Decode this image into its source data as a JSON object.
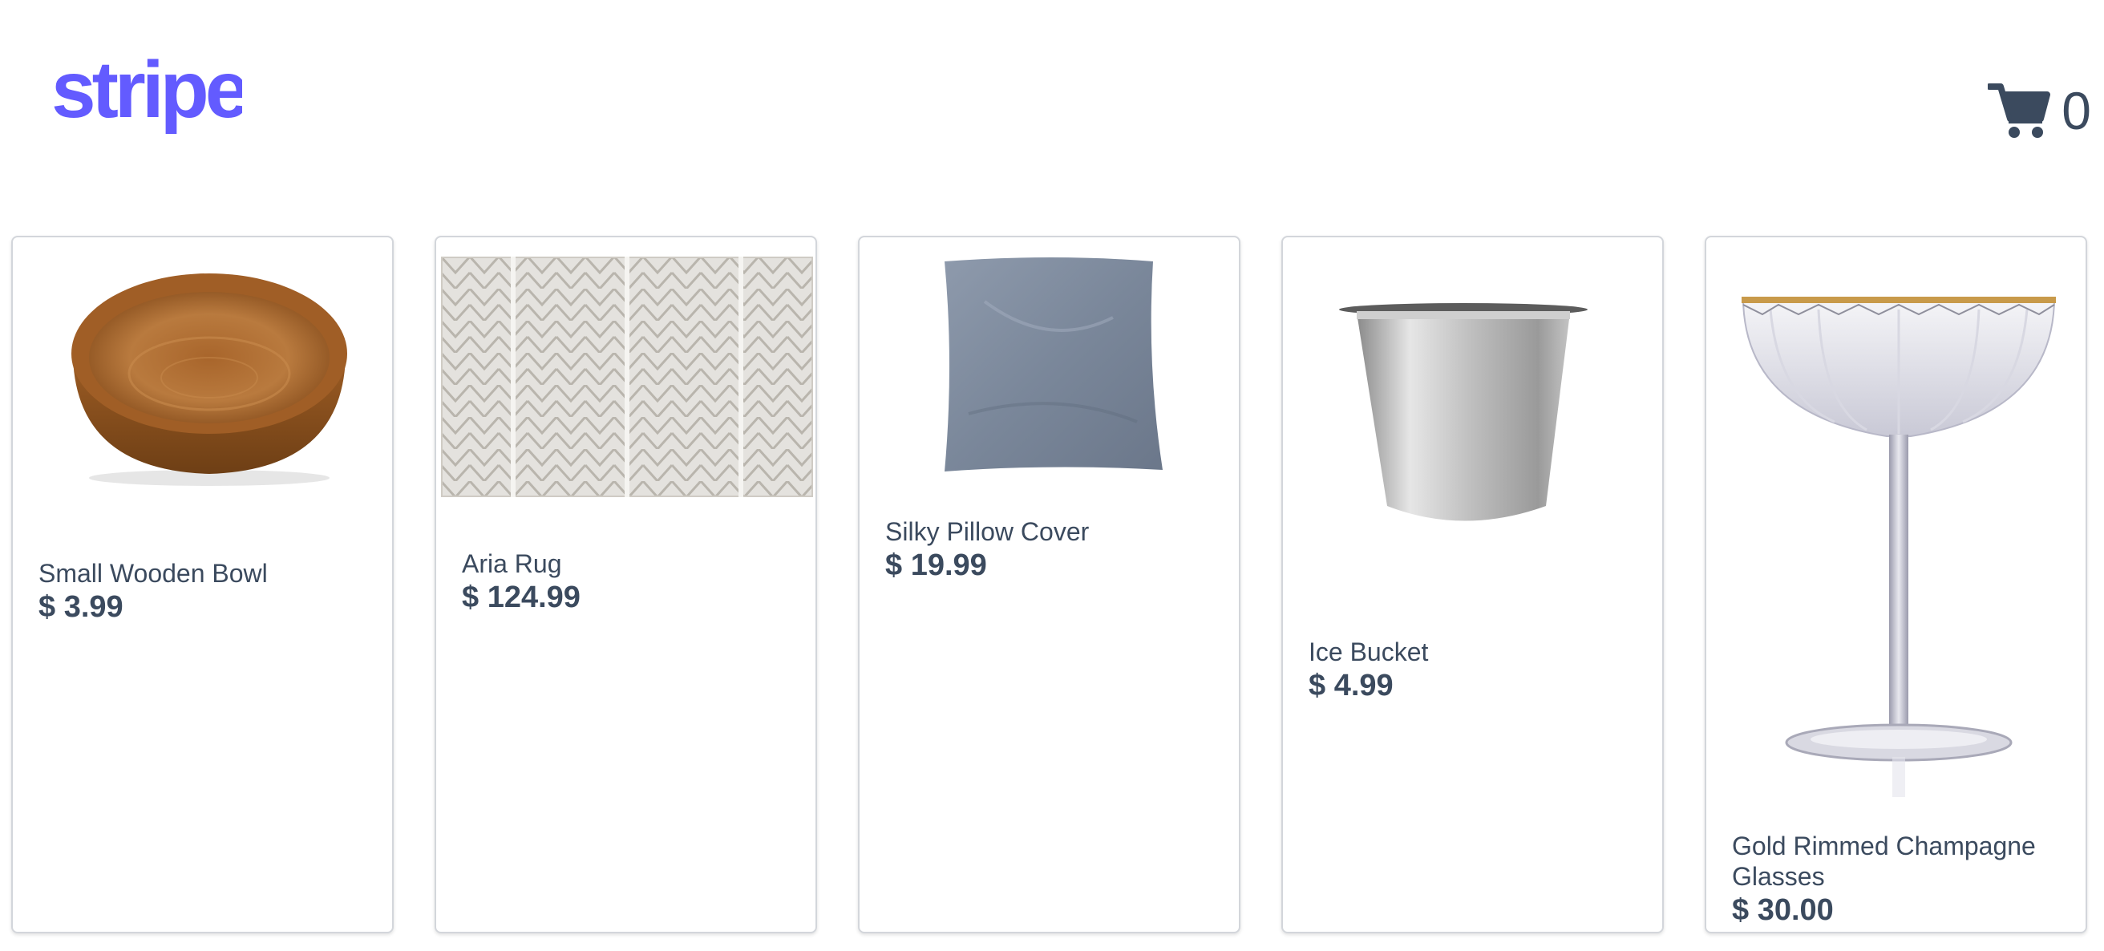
{
  "header": {
    "logo_text": "stripe",
    "logo_color": "#635bff",
    "cart_icon": "shopping-cart-icon",
    "cart_count": "0"
  },
  "products": [
    {
      "name": "Small Wooden Bowl",
      "price": "$ 3.99",
      "image": "wooden-bowl-image"
    },
    {
      "name": "Aria Rug",
      "price": "$ 124.99",
      "image": "rug-image"
    },
    {
      "name": "Silky Pillow Cover",
      "price": "$ 19.99",
      "image": "pillow-image"
    },
    {
      "name": "Ice Bucket",
      "price": "$ 4.99",
      "image": "ice-bucket-image"
    },
    {
      "name": "Gold Rimmed Champagne Glasses",
      "price": "$ 30.00",
      "image": "champagne-glass-image"
    }
  ]
}
